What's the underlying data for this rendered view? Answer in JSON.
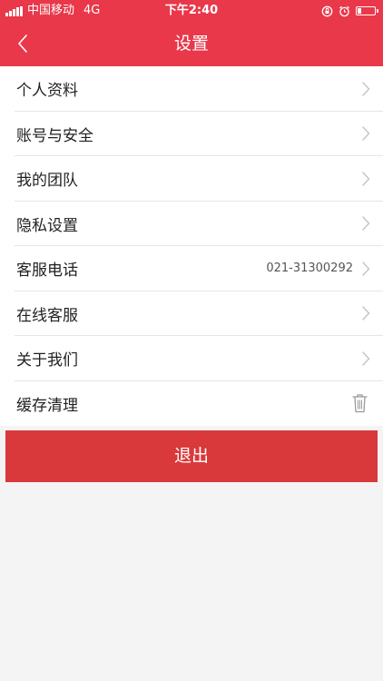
{
  "status_bar": {
    "carrier": "中国移动",
    "network": "4G",
    "time": "下午2:40",
    "battery_level": 0.25
  },
  "nav": {
    "title": "设置"
  },
  "settings": {
    "items": [
      {
        "label": "个人资料"
      },
      {
        "label": "账号与安全"
      },
      {
        "label": "我的团队"
      },
      {
        "label": "隐私设置"
      },
      {
        "label": "客服电话",
        "value": "021-31300292"
      },
      {
        "label": "在线客服"
      },
      {
        "label": "关于我们"
      },
      {
        "label": "缓存清理"
      }
    ]
  },
  "logout": {
    "label": "退出"
  },
  "colors": {
    "header": "#e8384a",
    "logout": "#d9393b",
    "background": "#f4f4f4"
  },
  "icons": {
    "back": "chevron-left-icon",
    "row_arrow": "chevron-right-icon",
    "cache": "trash-icon"
  }
}
